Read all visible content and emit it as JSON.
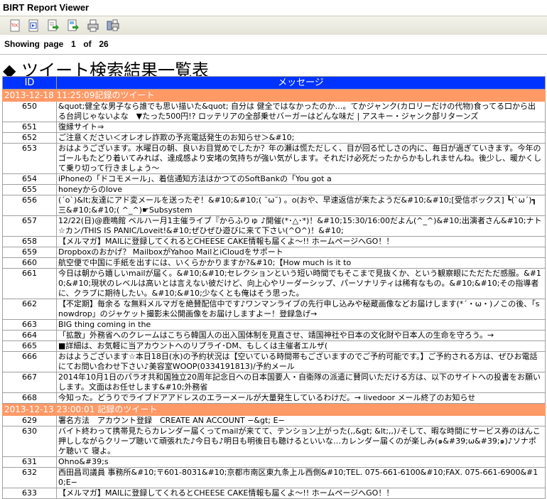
{
  "app": {
    "title": "BIRT Report Viewer"
  },
  "toolbar": {
    "icons": [
      "toc-icon",
      "run-report-icon",
      "export-data-icon",
      "export-report-icon",
      "print-icon",
      "print-server-icon"
    ]
  },
  "paging": {
    "text": "Showing page  1  of  26"
  },
  "report": {
    "title": "◆ ツイート検索結果一覧表",
    "col_id": "ID",
    "col_msg": "メッセージ",
    "group1": "2013-12-18 11:25:09記録のツイート",
    "group2": "2013-12-13 23:00:01 記録のツイート"
  },
  "rows1": [
    {
      "id": "650",
      "msg": "&quot;健全な男子なら誰でも思い描いた&quot; 自分は 健全ではなかったのか…。てかジャンク(カロリーだけの代物)食ってる口から出る台詞じゃないよな　▼たった500円!? ロッテリアの全部乗せバーガーはどんな味だ | アスキー・ジャンク部リターンズ"
    },
    {
      "id": "651",
      "msg": "復縁サイト⇒"
    },
    {
      "id": "652",
      "msg": "ご注意ください＜オレオレ詐欺の予兆電話発生のお知らせ＞&#10;"
    },
    {
      "id": "653",
      "msg": "おはようございます。水曜日の朝、良いお目覚めでしたか？年の瀬は慌ただしく、目が回る忙しさの内に、毎日が過ぎていきます。今年のゴールもたどり着いてみれば、達成感より安堵の気持ちが強い気がします。それだけ必死だったからかもしれませんね。後少し、暖かくして乗り切って行きましょう〜"
    },
    {
      "id": "654",
      "msg": "iPhoneの「ドコモメール」、着信通知方法はかつてのSoftBankの「You got a"
    },
    {
      "id": "655",
      "msg": "honeyからのlove"
    },
    {
      "id": "656",
      "msg": "(´o`)&lt;友達にアド変メールを送ったぞ！&#10;&#10;( ˘ω˘) 。o(おや、早速返信が来たようだ&#10;&#10;[受信ボックス] ┗(`ω´)┓三&#10;&#10;( ^_^)☛Subsystem"
    },
    {
      "id": "657",
      "msg": "12/22(日)@鹿鳴館 ベルハー月1主催ライブ『からふりゅ ♪開催(*･△･*)！&#10;15:30/16:00だよん(^_^)&#10;出演者さん&#10;ナト☆カン/THIS IS PANIC/Loveit!&#10;ぜひぜひ遊びに来て下さい(^O^)！&#10;"
    },
    {
      "id": "658",
      "msg": "【メルマガ】MAILに登録してくれるとCHEESE CAKE情報も届くよ〜!! ホームページへGO！！"
    },
    {
      "id": "659",
      "msg": "Dropboxのおかげ？ MailboxがYahoo MailとiCloudをサポート"
    },
    {
      "id": "660",
      "msg": "航空便で中国に手紙を出すには、いくらかかりますか?&#10;【How much is it to"
    },
    {
      "id": "661",
      "msg": "今日は朝から嬉しいmailが届く。&#10;&#10;セレクションという短い時間でもそこまで見抜くか、という観察眼にただただ感服。&#10;&#10;現状のレベルは高いとは言えない彼だけど、向上心やリーダーシップ、パーソナリティは稀有なもの。&#10;&#10;その指導者に、クラブに期待したい。&#10;&#10;少なくとも俺はそう思った。"
    },
    {
      "id": "662",
      "msg": "【不定期】毎余る な無料メルマガを絶賛配信中です♪ワンマンライブの先行申し込みや秘蔵画像などお届けします(*´・ω・)ノこの後、「snowdrop」のジャケット撮影未公開画像をお届けしますよー！登録急げ→"
    },
    {
      "id": "663",
      "msg": "BIG thing coming in the"
    },
    {
      "id": "664",
      "msg": "「拡散」外務省へのクレームはこちら韓国人の出入国体制を見直させ、靖国神社や日本の文化財や日本人の生命を守ろう。→"
    },
    {
      "id": "665",
      "msg": "■詳細は、お気軽に当アカウントへのリプライ･DM、もしくは主催者エルザ("
    },
    {
      "id": "666",
      "msg": "おはようございます☆本日18日(水)の予約状況は【空いている時間帯もございますのでご予約可能です。】ご予約される方は、ぜひお電話にてお問い合わせ下さい♪美容室WOOP(0334191813)/予約メール"
    },
    {
      "id": "667",
      "msg": "2014年10月1日のパラオ共和国独立20周年記念日への日本国要人・自衛隊の派遣に賛同いただける方は、以下のサイトへの投書をお願いします。文面はお任せします&#10;外務省"
    },
    {
      "id": "668",
      "msg": "今知った。どうりでライブドアアドレスのエラーメールが大量発生しているわけだ。→ livedoor メール終了のお知らせ"
    }
  ],
  "rows2": [
    {
      "id": "629",
      "msg": "署名方法　アカウント登録　CREATE AN ACCOUNT −&gt; E−"
    },
    {
      "id": "630",
      "msg": "バイト終わって携帯見たらカレンダー届くってmailが来てて、テンション上がった(,,&gt; &lt;,,)ﾉそして、暇な時間にサービス券のはんこ押ししながらクリープ聴いて頑張れた♪今日も♪明日も明後日も聴けるといいな…カレンダー届くのが楽しみ(๑&#39;ω&#39;๑)♪ソナポケ聴いて 寝よ。"
    },
    {
      "id": "631",
      "msg": "Ohno&#39;s"
    },
    {
      "id": "632",
      "msg": "西田昌司議員 事務所&#10;〒601-8031&#10;京都市南区東九条上ル西側&#10;TEL. 075-661-6100&#10;FAX. 075-661-6900&#10;E−"
    },
    {
      "id": "633",
      "msg": "【メルマガ】MAILに登録してくれるとCHEESE CAKE情報も届くよ〜!! ホームページへGO！！"
    }
  ]
}
